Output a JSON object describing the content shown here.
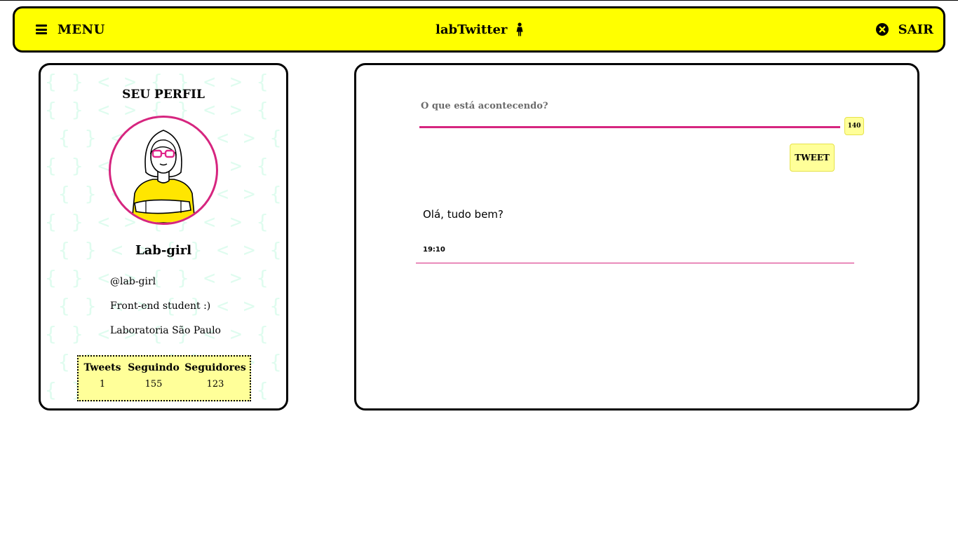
{
  "header": {
    "menu_label": "MENU",
    "brand": "labTwitter",
    "logout_label": "SAIR",
    "background_color": "#ffff00"
  },
  "profile": {
    "title": "SEU PERFIL",
    "name": "Lab-girl",
    "handle": "@lab-girl",
    "bio": "Front-end student :)",
    "location": "Laboratoria São Paulo",
    "stats": [
      {
        "label": "Tweets",
        "value": "1"
      },
      {
        "label": "Seguindo",
        "value": "155"
      },
      {
        "label": "Seguidores",
        "value": "123"
      }
    ],
    "accent_color": "#d6257f",
    "stats_background": "#ffff99"
  },
  "composer": {
    "placeholder": "O que está acontecendo?",
    "value": "",
    "char_count": "140",
    "button_label": "TWEET"
  },
  "tweets": [
    {
      "text": "Olá, tudo bem?",
      "time": "19:10"
    }
  ],
  "icons": {
    "menu": "hamburger-icon",
    "brand": "person-icon",
    "logout": "close-circle-icon"
  }
}
